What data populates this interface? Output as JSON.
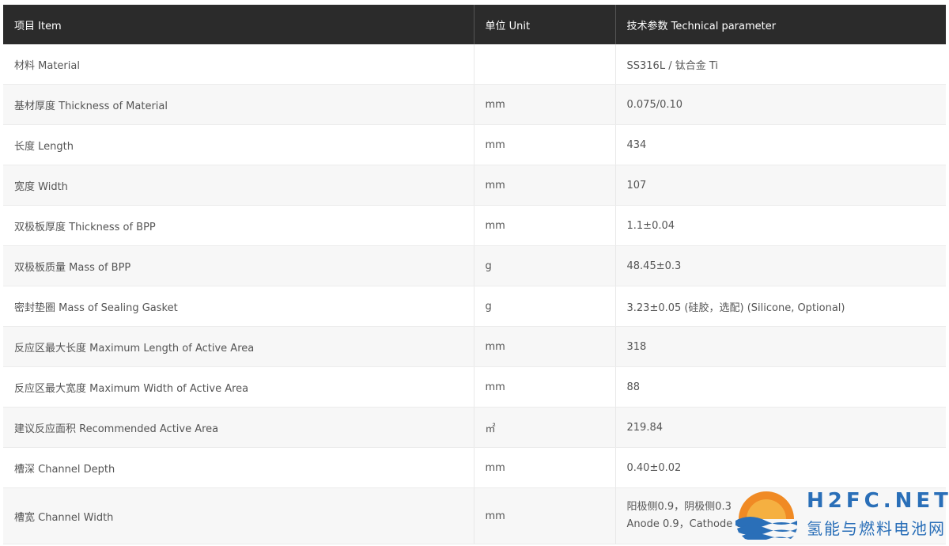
{
  "table": {
    "headers": [
      "项目 Item",
      "单位 Unit",
      "技术参数 Technical parameter"
    ],
    "rows": [
      {
        "item": "材料 Material",
        "unit": "",
        "param": "SS316L / 钛合金 Ti"
      },
      {
        "item": "基材厚度 Thickness of Material",
        "unit": "mm",
        "param": "0.075/0.10"
      },
      {
        "item": "长度 Length",
        "unit": "mm",
        "param": "434"
      },
      {
        "item": "宽度 Width",
        "unit": "mm",
        "param": "107"
      },
      {
        "item": "双极板厚度 Thickness of BPP",
        "unit": "mm",
        "param": "1.1±0.04"
      },
      {
        "item": "双极板质量 Mass of BPP",
        "unit": "g",
        "param": "48.45±0.3"
      },
      {
        "item": "密封垫圈 Mass of Sealing Gasket",
        "unit": "g",
        "param": "3.23±0.05 (硅胶，选配) (Silicone, Optional)"
      },
      {
        "item": "反应区最大长度 Maximum Length of Active Area",
        "unit": "mm",
        "param": "318"
      },
      {
        "item": "反应区最大宽度 Maximum Width of Active Area",
        "unit": "mm",
        "param": "88"
      },
      {
        "item": "建议反应面积 Recommended Active Area",
        "unit": "㎡",
        "param": "219.84"
      },
      {
        "item": "槽深 Channel Depth",
        "unit": "mm",
        "param": "0.40±0.02"
      },
      {
        "item": "槽宽 Channel Width",
        "unit": "mm",
        "param_lines": [
          "阳极侧0.9，阴极侧0.3",
          "Anode 0.9，Cathode 0."
        ]
      }
    ]
  },
  "watermark": {
    "domain": "H2FC.NET",
    "name_cn": "氢能与燃料电池网"
  },
  "colors": {
    "header_bg": "#2b2b2b",
    "row_alt": "#f7f7f7",
    "logo_blue": "#2a6fb8",
    "logo_orange": "#f08a24"
  }
}
